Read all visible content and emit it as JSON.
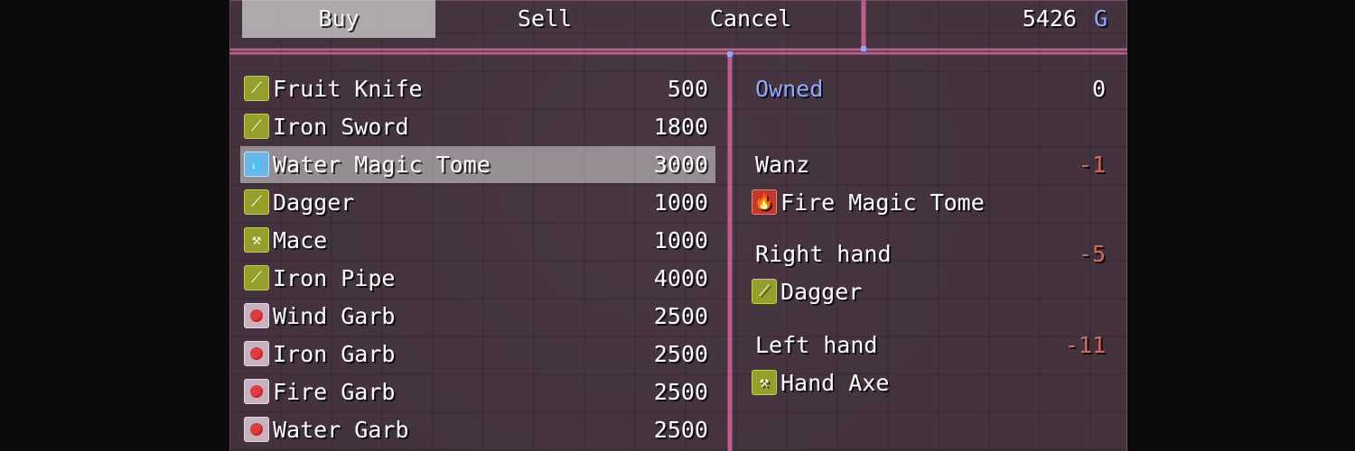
{
  "commands": {
    "buy": "Buy",
    "sell": "Sell",
    "cancel": "Cancel",
    "selected": "Buy"
  },
  "gold": {
    "amount": "5426",
    "unit": "G"
  },
  "shop_items": [
    {
      "name": "Fruit Knife",
      "price": "500",
      "icon": "knife-icon"
    },
    {
      "name": "Iron Sword",
      "price": "1800",
      "icon": "sword-icon"
    },
    {
      "name": "Water Magic Tome",
      "price": "3000",
      "icon": "water-drop-icon",
      "selected": true
    },
    {
      "name": "Dagger",
      "price": "1000",
      "icon": "dagger-icon"
    },
    {
      "name": "Mace",
      "price": "1000",
      "icon": "mace-icon"
    },
    {
      "name": "Iron Pipe",
      "price": "4000",
      "icon": "pipe-icon"
    },
    {
      "name": "Wind Garb",
      "price": "2500",
      "icon": "garb-icon"
    },
    {
      "name": "Iron Garb",
      "price": "2500",
      "icon": "garb-icon"
    },
    {
      "name": "Fire Garb",
      "price": "2500",
      "icon": "garb-icon"
    },
    {
      "name": "Water Garb",
      "price": "2500",
      "icon": "garb-icon"
    }
  ],
  "status": {
    "owned_label": "Owned",
    "owned_value": "0",
    "actor_name": "Wanz",
    "actor_change": "-1",
    "actor_item": "Fire Magic Tome",
    "right_hand_label": "Right hand",
    "right_hand_change": "-5",
    "right_hand_item": "Dagger",
    "left_hand_label": "Left hand",
    "left_hand_change": "-11",
    "left_hand_item": "Hand Axe"
  },
  "colors": {
    "window_border": "#c45a8c",
    "system_text": "#8fa8ff",
    "negative_change": "#d36a55",
    "weapon_icon": "#95a02c",
    "magic_icon": "#6ab6e6"
  }
}
